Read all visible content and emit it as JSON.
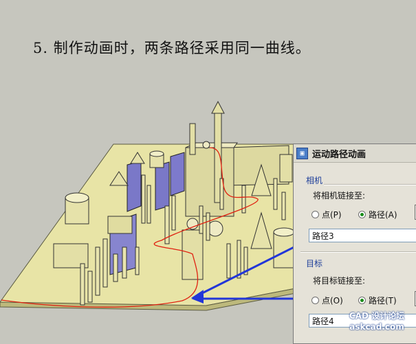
{
  "caption": "5. 制作动画时，两条路径采用同一曲线。",
  "dialog": {
    "title": "运动路径动画",
    "camera": {
      "group_label": "相机",
      "link_label": "将相机链接至:",
      "option_point": "点(P)",
      "option_path": "路径(A)",
      "selected": "path",
      "path_value": "路径3"
    },
    "target": {
      "group_label": "目标",
      "link_label": "将目标链接至:",
      "option_point": "点(O)",
      "option_path": "路径(T)",
      "selected": "path",
      "path_value": "路径4"
    }
  },
  "watermark": {
    "line1": "CAD 设计论坛",
    "line2": "askcad.com"
  },
  "colors": {
    "background": "#c6c6be",
    "model_face": "#e8e4a6",
    "path_curve": "#e02010",
    "arrow": "#2236d8"
  }
}
